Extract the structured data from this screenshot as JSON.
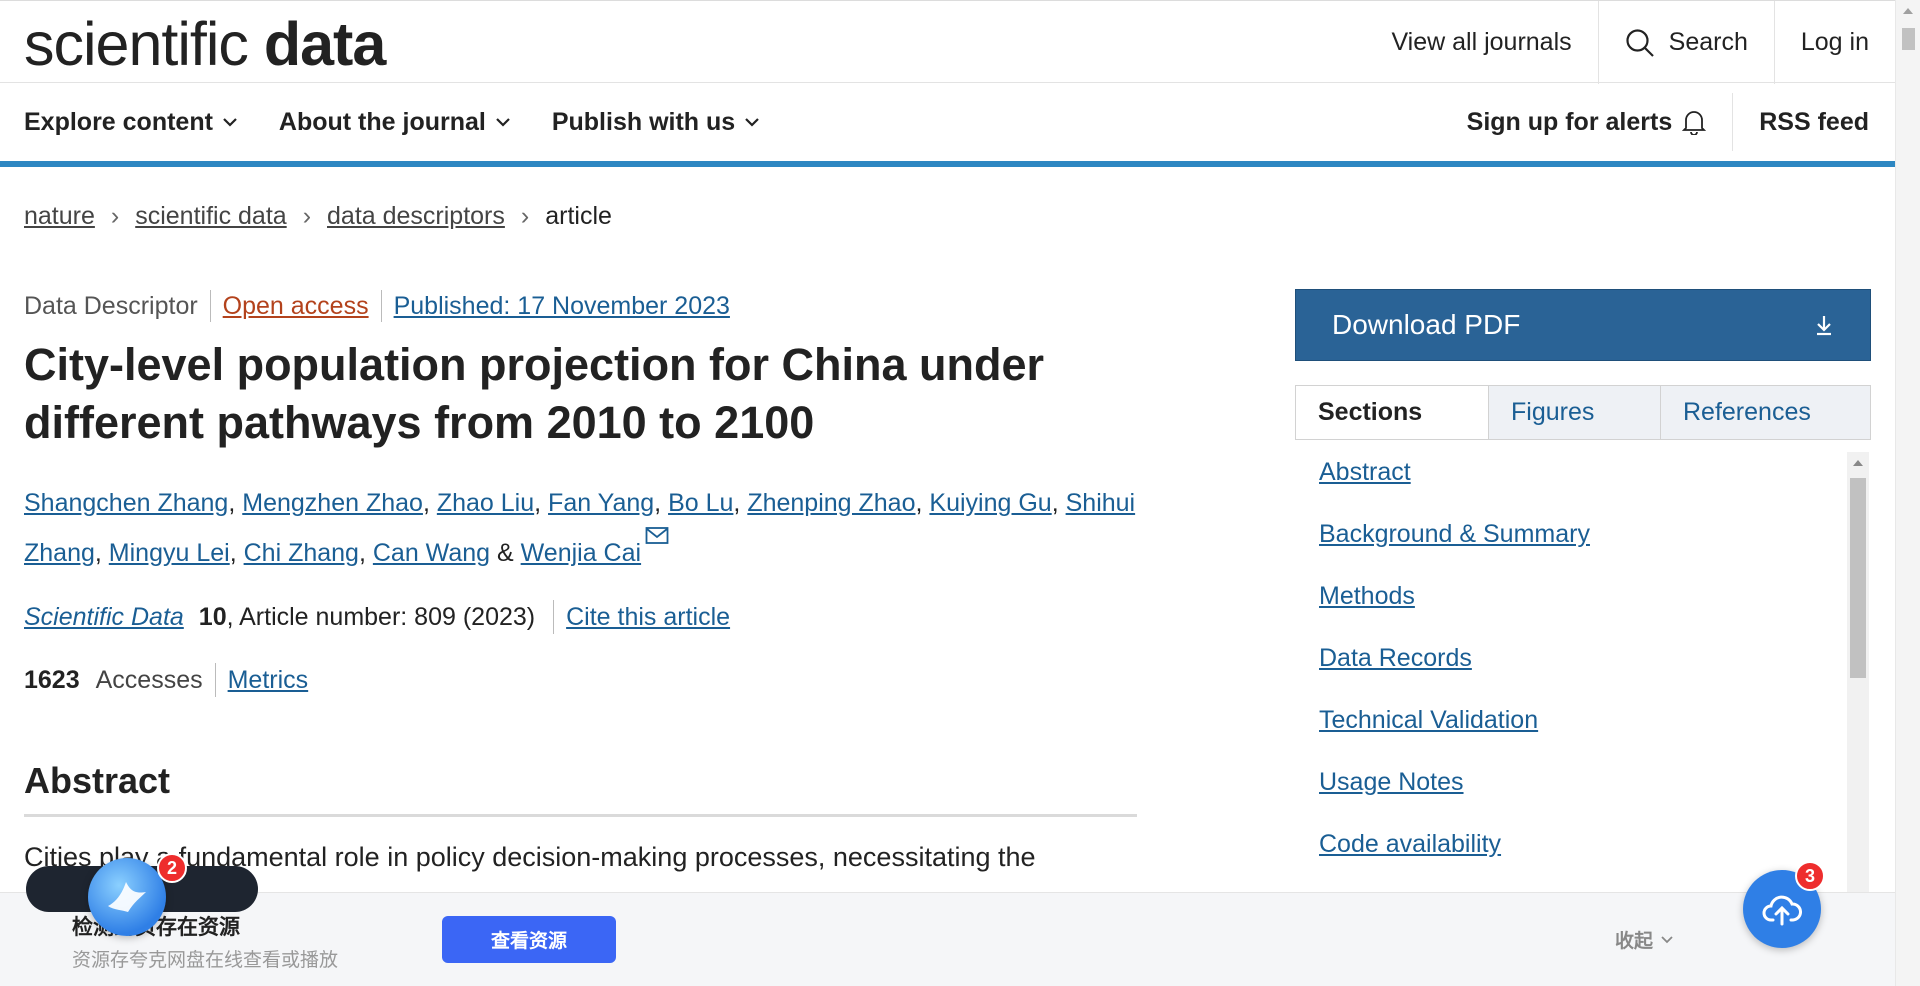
{
  "header": {
    "logo_light": "scientific",
    "logo_bold": "data",
    "view_all": "View all journals",
    "search": "Search",
    "login": "Log in"
  },
  "nav": {
    "items": [
      {
        "label": "Explore content"
      },
      {
        "label": "About the journal"
      },
      {
        "label": "Publish with us"
      }
    ],
    "alerts": "Sign up for alerts",
    "rss": "RSS feed"
  },
  "breadcrumb": {
    "items": [
      "nature",
      "scientific data",
      "data descriptors"
    ],
    "current": "article"
  },
  "article": {
    "type": "Data Descriptor",
    "open_access": "Open access",
    "published": "Published: 17 November 2023",
    "title": "City-level population projection for China under different pathways from 2010 to 2100",
    "authors": [
      "Shangchen Zhang",
      "Mengzhen Zhao",
      "Zhao Liu",
      "Fan Yang",
      "Bo Lu",
      "Zhenping Zhao",
      "Kuiying Gu",
      "Shihui Zhang",
      "Mingyu Lei",
      "Chi Zhang",
      "Can Wang",
      "Wenjia Cai"
    ],
    "author_sep": ", ",
    "author_and": " & ",
    "journal": "Scientific Data",
    "volume": "10",
    "article_number": ", Article number: 809 (2023)",
    "cite": "Cite this article",
    "accesses_count": "1623",
    "accesses_label": "Accesses",
    "metrics": "Metrics",
    "abstract_heading": "Abstract",
    "abstract_text": "Cities play a fundamental role in policy decision-making processes, necessitating the"
  },
  "sidebar": {
    "download": "Download PDF",
    "tabs": [
      "Sections",
      "Figures",
      "References"
    ],
    "sections": [
      "Abstract",
      "Background & Summary",
      "Methods",
      "Data Records",
      "Technical Validation",
      "Usage Notes",
      "Code availability"
    ]
  },
  "overlay": {
    "title": "检测到页存在资源",
    "subtitle": "资源存夸克网盘在线查看或播放",
    "button": "查看资源",
    "collapse": "收起",
    "badge_left": "2",
    "badge_right": "3"
  },
  "colors": {
    "accent_blue": "#2d87c2",
    "download_bg": "#2a6396",
    "link": "#1a5e94",
    "open_access": "#b3421c",
    "overlay_button": "#3b66f5"
  },
  "icons": [
    "search-icon",
    "chevron-down-icon",
    "bell-icon",
    "download-icon",
    "mail-icon",
    "cloud-upload-icon",
    "bird-icon"
  ]
}
